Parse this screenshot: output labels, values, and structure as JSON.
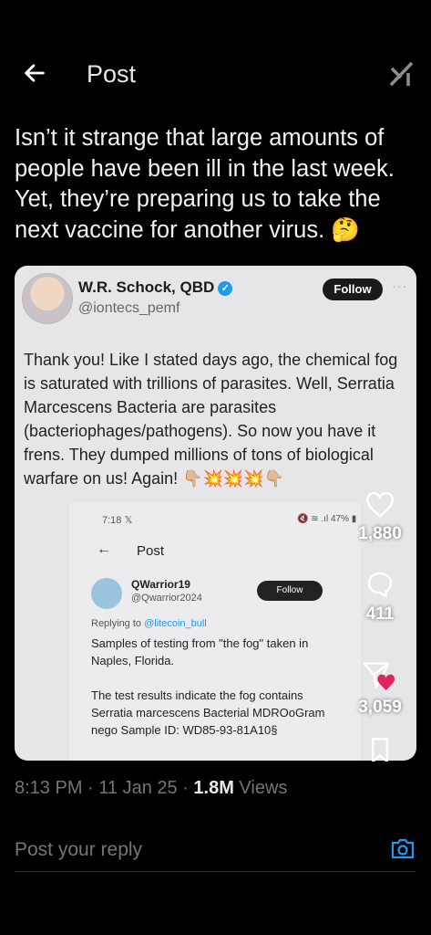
{
  "header": {
    "title": "Post"
  },
  "tweet": {
    "text": "Isn’t it strange that large amounts of people have been ill in the last week. Yet, they’re preparing us to take the next vaccine for another virus. 🤔",
    "timestamp": "8:13 PM · 11 Jan 25 · ",
    "views_count": "1.8M",
    "views_label": " Views"
  },
  "media": {
    "author_name": "W.R. Schock, QBD",
    "author_handle": "@iontecs_pemf",
    "follow_label": "Follow",
    "text": "Thank you! Like I stated days ago, the chemical fog is saturated with trillions of parasites. Well, Serratia Marcescens Bacteria are parasites (bacteriophages/pathogens). So now you have it frens. They dumped millions of tons of biological warfare on us! Again! 👇🏼💥💥💥👇🏼",
    "screenshot": {
      "status_time": "7:18 𝕏",
      "status_right": "🔇 ≋ .ıl 47% ▮",
      "back": "←",
      "title": "Post",
      "name": "QWarrior19",
      "handle": "@Qwarrior2024",
      "follow_label": "Follow",
      "replying_prefix": "Replying to ",
      "replying_handle": "@litecoin_bull",
      "text1": "Samples of testing from \"the fog\" taken in Naples, Florida.",
      "text2": "The test results indicate the fog contains Serratia marcescens Bacterial MDROoGram nego Sample ID: WD85-93-81A10§"
    }
  },
  "actions": {
    "likes": "1,880",
    "replies": "411",
    "shares": "3,059"
  },
  "reply": {
    "placeholder": "Post your reply"
  },
  "colors": {
    "accent": "#1d9bf0",
    "like": "#f91880",
    "background": "#000000"
  }
}
